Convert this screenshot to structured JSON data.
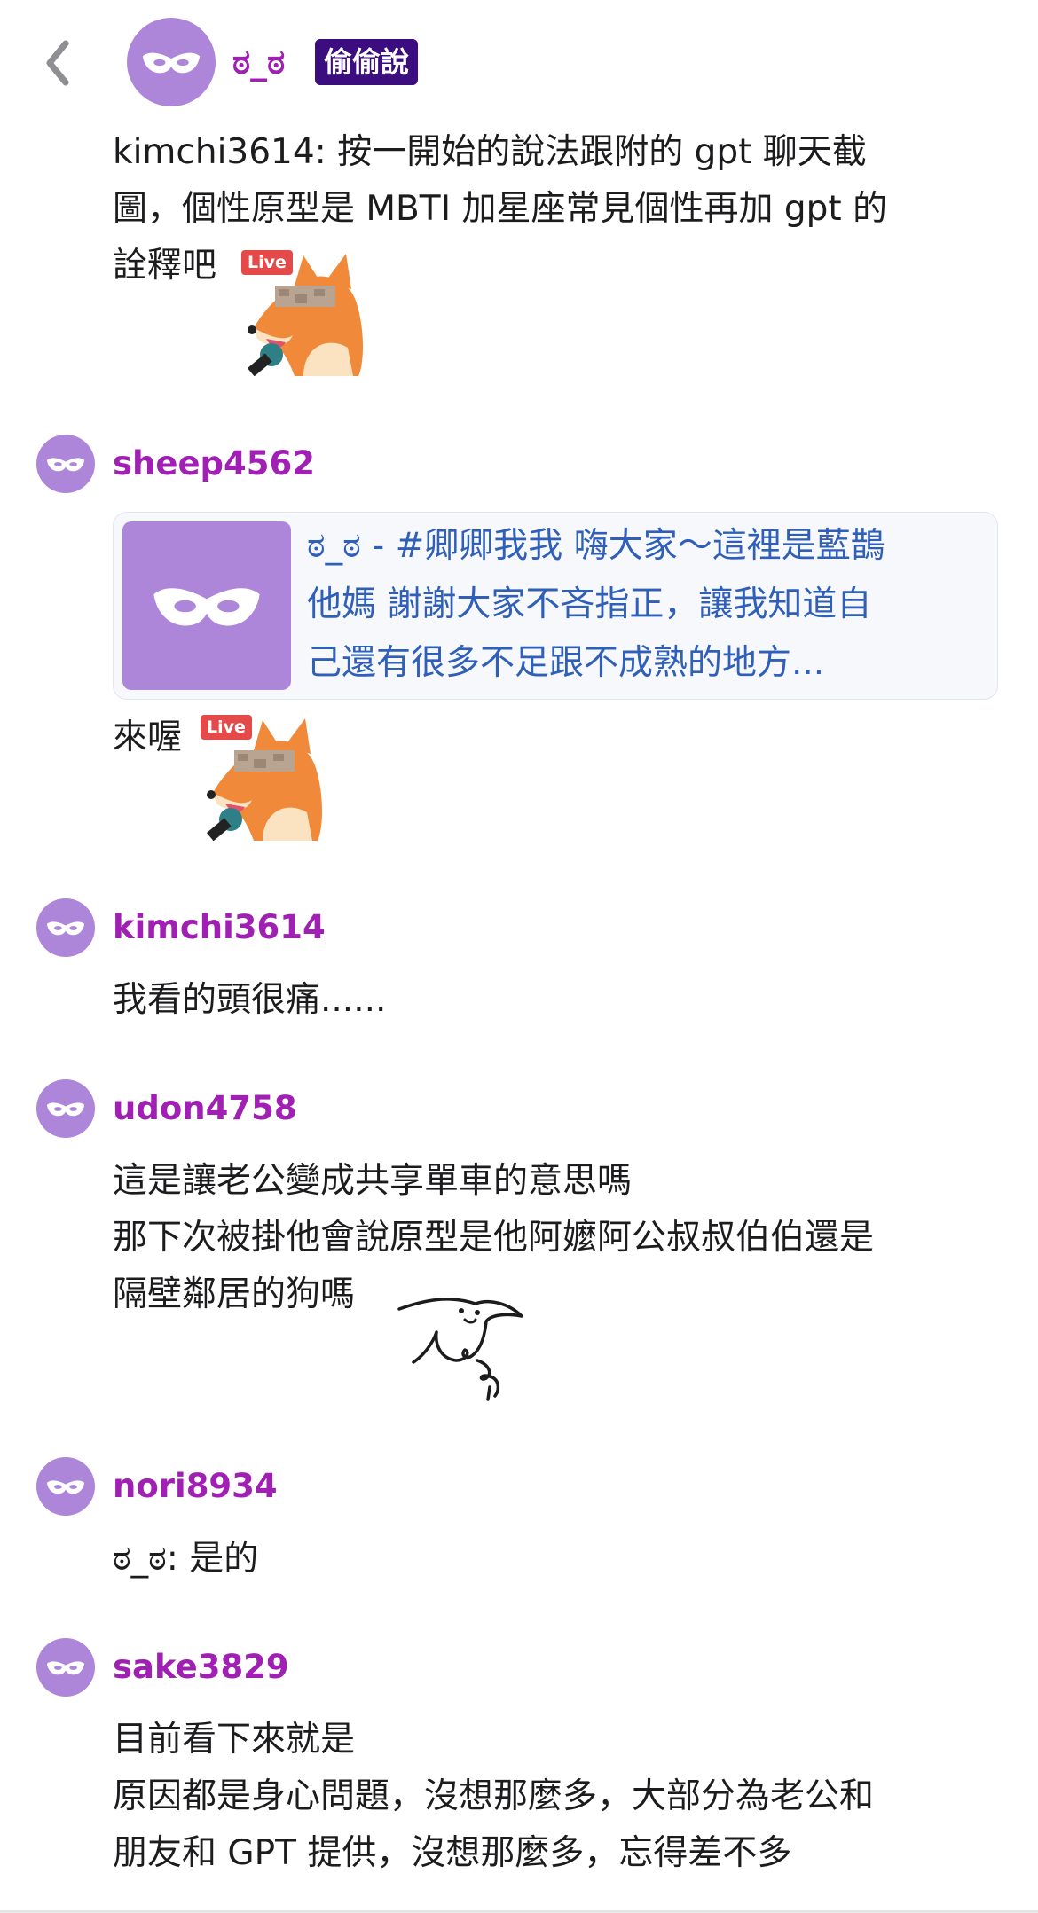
{
  "header": {
    "back_icon": "chevron-left-icon",
    "avatar_icon": "mask-icon",
    "author": "ಠ_ಠ",
    "badge": "偷偷說"
  },
  "post": {
    "lines": [
      "kimchi3614: 按一開始的說法跟附的 gpt 聊天截",
      "圖，個性原型是 MBTI 加星座常見個性再加 gpt 的",
      "詮釋吧"
    ],
    "sticker": "fox-live-mic-sticker",
    "sticker_tag": "Live"
  },
  "comments": [
    {
      "username": "sheep4562",
      "link_preview": {
        "lines": [
          "ಠ_ಠ - #卿卿我我 嗨大家～這裡是藍鵲",
          "他媽 謝謝大家不吝指正，讓我知道自",
          "己還有很多不足跟不成熟的地方..."
        ]
      },
      "text": "來喔",
      "sticker": "fox-live-mic-sticker",
      "sticker_tag": "Live"
    },
    {
      "username": "kimchi3614",
      "text": "我看的頭很痛......"
    },
    {
      "username": "udon4758",
      "lines": [
        "這是讓老公變成共享單車的意思嗎",
        "那下次被掛他會說原型是他阿嬤阿公叔叔伯伯還是",
        "隔壁鄰居的狗嗎"
      ],
      "sticker": "bird-doodle-sticker"
    },
    {
      "username": "nori8934",
      "text": "ಠ_ಠ: 是的"
    },
    {
      "username": "sake3829",
      "lines": [
        "目前看下來就是",
        "原因都是身心問題，沒想那麼多，大部分為老公和",
        "朋友和 GPT 提供，沒想那麼多，忘得差不多"
      ]
    }
  ],
  "colors": {
    "username": "#a020b4",
    "avatar": "#ad86d9",
    "badge_bg": "#3b0d7e",
    "link": "#2f5fb8"
  }
}
